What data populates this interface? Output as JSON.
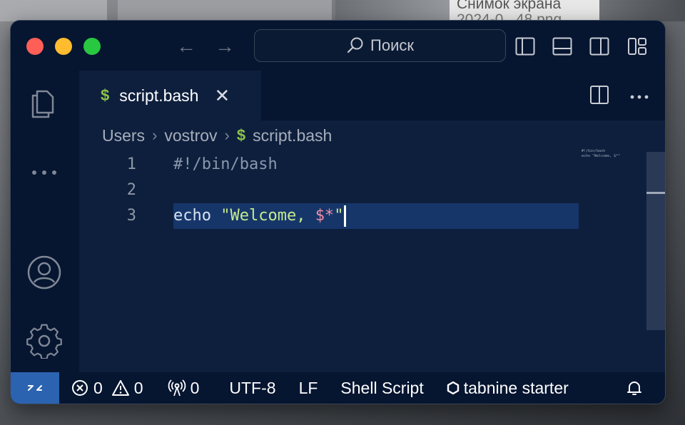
{
  "desktop": {
    "thumbnail_text_1": "Снимок экрана",
    "thumbnail_text_2": "2024-0...48.png"
  },
  "titlebar": {
    "search_placeholder": "Поиск"
  },
  "tab": {
    "icon": "$",
    "label": "script.bash"
  },
  "breadcrumb": {
    "items": [
      "Users",
      "vostrov",
      "script.bash"
    ],
    "file_icon": "$"
  },
  "editor": {
    "lines": [
      {
        "number": "1",
        "text": "#!/bin/bash"
      },
      {
        "number": "2",
        "text": ""
      },
      {
        "number": "3",
        "keyword": "echo",
        "string_open": "\"Welcome, ",
        "variable": "$*",
        "string_close": "\""
      }
    ],
    "minimap_line_1": "#!/bin/bash",
    "minimap_line_3": "echo \"Welcome, $*\""
  },
  "statusbar": {
    "errors": "0",
    "warnings": "0",
    "ports": "0",
    "encoding": "UTF-8",
    "eol": "LF",
    "language": "Shell Script",
    "tabnine": "tabnine starter"
  },
  "colors": {
    "editor_bg": "#0e1f3d",
    "chrome_bg": "#061530",
    "remote_accent": "#2b63b0",
    "string": "#c6ea8f",
    "variable": "#f08da6"
  }
}
